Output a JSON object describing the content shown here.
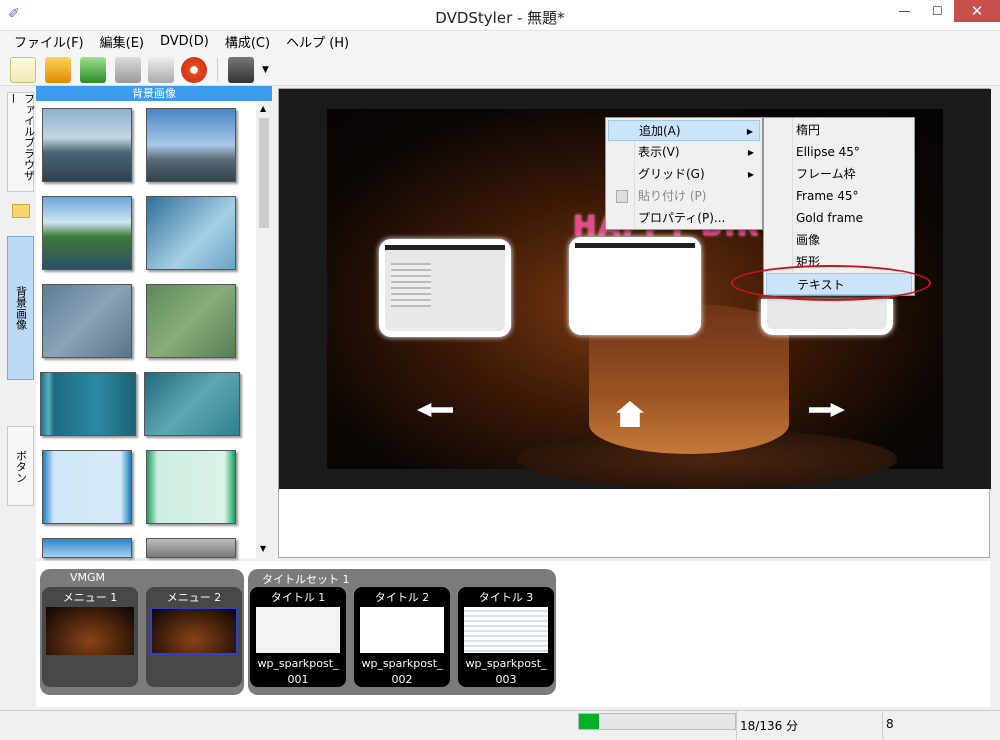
{
  "window": {
    "title": "DVDStyler - 無題*",
    "minimize": "—",
    "maximize": "☐",
    "close": "✕"
  },
  "menubar": [
    {
      "label": "ファイル(F)"
    },
    {
      "label": "編集(E)"
    },
    {
      "label": "DVD(D)"
    },
    {
      "label": "構成(C)"
    },
    {
      "label": "ヘルプ (H)"
    }
  ],
  "toolbar": {
    "icons": [
      "new-file-icon",
      "open-folder-icon",
      "save-icon",
      "settings-icon",
      "tools-icon",
      "burn-icon",
      "add-video-icon",
      "dropdown-icon"
    ]
  },
  "sidetabs": [
    {
      "label": "ファイルブラウザー"
    },
    {
      "label": "背景画像"
    },
    {
      "label": "ボタン"
    }
  ],
  "background_panel": {
    "header": "背景画像"
  },
  "context_menu": {
    "items": [
      {
        "label": "追加(A)",
        "submenu": true,
        "highlighted": true
      },
      {
        "label": "表示(V)",
        "submenu": true
      },
      {
        "label": "グリッド(G)",
        "submenu": true
      },
      {
        "label": "貼り付け (P)",
        "disabled": true
      },
      {
        "label": "プロパティ(P)..."
      }
    ],
    "submenu": [
      {
        "label": "楕円"
      },
      {
        "label": "Ellipse 45°"
      },
      {
        "label": "フレーム枠"
      },
      {
        "label": "Frame 45°"
      },
      {
        "label": "Gold frame"
      },
      {
        "label": "画像"
      },
      {
        "label": "矩形"
      },
      {
        "label": "テキスト",
        "highlighted": true
      }
    ]
  },
  "canvas": {
    "cake_text": "HAPPY BIRTHDAY"
  },
  "titles": {
    "vmgm": {
      "label": "VMGM",
      "menus": [
        {
          "label": "メニュー 1"
        },
        {
          "label": "メニュー 2"
        }
      ]
    },
    "titleset": {
      "label": "タイトルセット 1",
      "titles": [
        {
          "label": "タイトル 1",
          "file": "wp_sparkpost_",
          "num": "001"
        },
        {
          "label": "タイトル 2",
          "file": "wp_sparkpost_",
          "num": "002"
        },
        {
          "label": "タイトル 3",
          "file": "wp_sparkpost_",
          "num": "003"
        }
      ]
    }
  },
  "status": {
    "progress_text": "18/136 分",
    "progress_fraction": 0.13,
    "count": "8"
  },
  "colors": {
    "accent": "#3c9bef",
    "progress": "#06b025",
    "highlight": "#cce4f7",
    "annotation": "#c8151b"
  }
}
